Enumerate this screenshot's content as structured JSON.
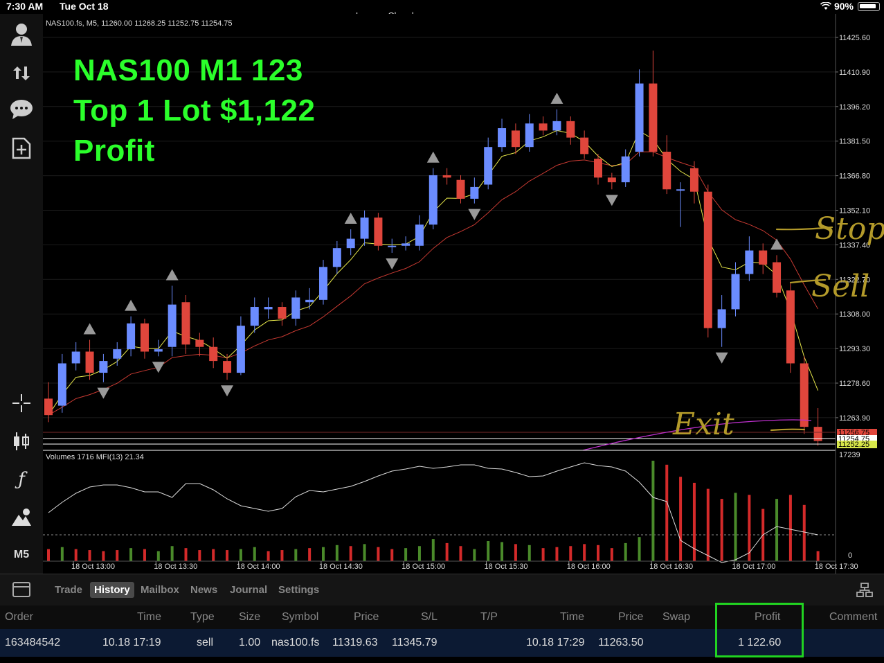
{
  "status": {
    "time": "7:30 AM",
    "date": "Tue Oct 18",
    "battery": "90%",
    "window_title": "Lennox Chambers"
  },
  "chart_info": "NAS100.fs, M5, 11260.00 11268.25 11252.75 11254.75",
  "overlay": {
    "line1": "NAS100 M1 123",
    "line2": "Top  1 Lot $1,122",
    "line3": "Profit"
  },
  "annotations": {
    "stop": "Stop",
    "sell": "Sell",
    "exit": "Exit"
  },
  "sidebar": {
    "timeframe": "M5",
    "icons": [
      "account-icon",
      "transfer-icon",
      "chat-icon",
      "new-order-icon",
      "crosshair-icon",
      "chart-type-icon",
      "indicators-icon",
      "objects-icon"
    ]
  },
  "volume_info": "Volumes 1716 MFI(13) 21.34",
  "volume_axis": {
    "max": "17239",
    "min": "0"
  },
  "chart_data": {
    "type": "candlestick",
    "symbol": "NAS100.fs",
    "timeframe": "M5",
    "price_axis": [
      "11425.60",
      "11410.90",
      "11396.20",
      "11381.50",
      "11366.80",
      "11352.10",
      "11337.40",
      "11322.70",
      "11308.00",
      "11293.30",
      "11278.60",
      "11263.90"
    ],
    "price_tags": [
      {
        "label": "11256.75",
        "color": "#e0463c"
      },
      {
        "label": "11254.75",
        "color": "#ffffff"
      },
      {
        "label": "11252.25",
        "color": "#d8e84a"
      }
    ],
    "ylim": [
      11252.25,
      11425.6
    ],
    "x_labels": [
      "18 Oct 13:00",
      "18 Oct 13:30",
      "18 Oct 14:00",
      "18 Oct 14:30",
      "18 Oct 15:00",
      "18 Oct 15:30",
      "18 Oct 16:00",
      "18 Oct 16:30",
      "18 Oct 17:00",
      "18 Oct 17:30"
    ],
    "candles": [
      {
        "o": 11272,
        "c": 11265,
        "h": 11279,
        "l": 11262
      },
      {
        "o": 11269,
        "c": 11287,
        "h": 11291,
        "l": 11266
      },
      {
        "o": 11287,
        "c": 11292,
        "h": 11296,
        "l": 11284
      },
      {
        "o": 11292,
        "c": 11283,
        "h": 11297,
        "l": 11280
      },
      {
        "o": 11283,
        "c": 11288,
        "h": 11291,
        "l": 11279
      },
      {
        "o": 11289,
        "c": 11293,
        "h": 11296,
        "l": 11286
      },
      {
        "o": 11293,
        "c": 11304,
        "h": 11307,
        "l": 11290
      },
      {
        "o": 11304,
        "c": 11292,
        "h": 11306,
        "l": 11289
      },
      {
        "o": 11292,
        "c": 11293,
        "h": 11297,
        "l": 11290
      },
      {
        "o": 11294,
        "c": 11312,
        "h": 11320,
        "l": 11290
      },
      {
        "o": 11313,
        "c": 11295,
        "h": 11316,
        "l": 11291
      },
      {
        "o": 11297,
        "c": 11294,
        "h": 11300,
        "l": 11290
      },
      {
        "o": 11294,
        "c": 11288,
        "h": 11298,
        "l": 11285
      },
      {
        "o": 11288,
        "c": 11283,
        "h": 11291,
        "l": 11280
      },
      {
        "o": 11283,
        "c": 11303,
        "h": 11307,
        "l": 11282
      },
      {
        "o": 11303,
        "c": 11311,
        "h": 11315,
        "l": 11300
      },
      {
        "o": 11310,
        "c": 11311,
        "h": 11315,
        "l": 11306
      },
      {
        "o": 11311,
        "c": 11306,
        "h": 11313,
        "l": 11303
      },
      {
        "o": 11306,
        "c": 11315,
        "h": 11318,
        "l": 11303
      },
      {
        "o": 11313,
        "c": 11314,
        "h": 11319,
        "l": 11310
      },
      {
        "o": 11314,
        "c": 11328,
        "h": 11331,
        "l": 11312
      },
      {
        "o": 11328,
        "c": 11336,
        "h": 11339,
        "l": 11325
      },
      {
        "o": 11336,
        "c": 11340,
        "h": 11344,
        "l": 11333
      },
      {
        "o": 11340,
        "c": 11349,
        "h": 11352,
        "l": 11337
      },
      {
        "o": 11349,
        "c": 11337,
        "h": 11351,
        "l": 11335
      },
      {
        "o": 11337,
        "c": 11337,
        "h": 11340,
        "l": 11334
      },
      {
        "o": 11337,
        "c": 11338,
        "h": 11341,
        "l": 11335
      },
      {
        "o": 11337,
        "c": 11346,
        "h": 11350,
        "l": 11335
      },
      {
        "o": 11346,
        "c": 11367,
        "h": 11370,
        "l": 11344
      },
      {
        "o": 11367,
        "c": 11366,
        "h": 11370,
        "l": 11363
      },
      {
        "o": 11365,
        "c": 11357,
        "h": 11367,
        "l": 11355
      },
      {
        "o": 11357,
        "c": 11362,
        "h": 11366,
        "l": 11355
      },
      {
        "o": 11363,
        "c": 11379,
        "h": 11383,
        "l": 11361
      },
      {
        "o": 11379,
        "c": 11387,
        "h": 11391,
        "l": 11377
      },
      {
        "o": 11386,
        "c": 11379,
        "h": 11389,
        "l": 11376
      },
      {
        "o": 11379,
        "c": 11389,
        "h": 11393,
        "l": 11377
      },
      {
        "o": 11389,
        "c": 11386,
        "h": 11392,
        "l": 11384
      },
      {
        "o": 11386,
        "c": 11390,
        "h": 11395,
        "l": 11384
      },
      {
        "o": 11390,
        "c": 11383,
        "h": 11392,
        "l": 11380
      },
      {
        "o": 11383,
        "c": 11376,
        "h": 11386,
        "l": 11374
      },
      {
        "o": 11374,
        "c": 11366,
        "h": 11376,
        "l": 11363
      },
      {
        "o": 11366,
        "c": 11364,
        "h": 11368,
        "l": 11361
      },
      {
        "o": 11364,
        "c": 11375,
        "h": 11378,
        "l": 11362
      },
      {
        "o": 11377,
        "c": 11406,
        "h": 11412,
        "l": 11375
      },
      {
        "o": 11406,
        "c": 11377,
        "h": 11420,
        "l": 11375
      },
      {
        "o": 11377,
        "c": 11361,
        "h": 11384,
        "l": 11359
      },
      {
        "o": 11361,
        "c": 11361,
        "h": 11364,
        "l": 11345
      },
      {
        "o": 11370,
        "c": 11360,
        "h": 11373,
        "l": 11355
      },
      {
        "o": 11360,
        "c": 11302,
        "h": 11363,
        "l": 11298
      },
      {
        "o": 11302,
        "c": 11310,
        "h": 11316,
        "l": 11294
      },
      {
        "o": 11310,
        "c": 11325,
        "h": 11330,
        "l": 11307
      },
      {
        "o": 11325,
        "c": 11335,
        "h": 11341,
        "l": 11322
      },
      {
        "o": 11335,
        "c": 11329,
        "h": 11338,
        "l": 11325
      },
      {
        "o": 11330,
        "c": 11317,
        "h": 11333,
        "l": 11315
      },
      {
        "o": 11318,
        "c": 11287,
        "h": 11321,
        "l": 11283
      },
      {
        "o": 11287,
        "c": 11260,
        "h": 11290,
        "l": 11257
      },
      {
        "o": 11260,
        "c": 11254,
        "h": 11268,
        "l": 11252
      }
    ],
    "volume_bars": [
      {
        "v": 12,
        "up": false
      },
      {
        "v": 14,
        "up": true
      },
      {
        "v": 12,
        "up": false
      },
      {
        "v": 11,
        "up": false
      },
      {
        "v": 10,
        "up": false
      },
      {
        "v": 11,
        "up": false
      },
      {
        "v": 13,
        "up": true
      },
      {
        "v": 12,
        "up": false
      },
      {
        "v": 10,
        "up": true
      },
      {
        "v": 15,
        "up": true
      },
      {
        "v": 13,
        "up": false
      },
      {
        "v": 11,
        "up": false
      },
      {
        "v": 12,
        "up": false
      },
      {
        "v": 11,
        "up": false
      },
      {
        "v": 12,
        "up": true
      },
      {
        "v": 14,
        "up": true
      },
      {
        "v": 10,
        "up": false
      },
      {
        "v": 11,
        "up": false
      },
      {
        "v": 12,
        "up": true
      },
      {
        "v": 13,
        "up": false
      },
      {
        "v": 14,
        "up": true
      },
      {
        "v": 16,
        "up": true
      },
      {
        "v": 15,
        "up": false
      },
      {
        "v": 17,
        "up": true
      },
      {
        "v": 14,
        "up": false
      },
      {
        "v": 12,
        "up": false
      },
      {
        "v": 13,
        "up": true
      },
      {
        "v": 15,
        "up": true
      },
      {
        "v": 22,
        "up": true
      },
      {
        "v": 18,
        "up": false
      },
      {
        "v": 15,
        "up": false
      },
      {
        "v": 12,
        "up": true
      },
      {
        "v": 20,
        "up": true
      },
      {
        "v": 19,
        "up": true
      },
      {
        "v": 17,
        "up": false
      },
      {
        "v": 16,
        "up": true
      },
      {
        "v": 13,
        "up": false
      },
      {
        "v": 14,
        "up": false
      },
      {
        "v": 15,
        "up": false
      },
      {
        "v": 17,
        "up": false
      },
      {
        "v": 16,
        "up": false
      },
      {
        "v": 13,
        "up": false
      },
      {
        "v": 18,
        "up": true
      },
      {
        "v": 24,
        "up": true
      },
      {
        "v": 100,
        "up": true
      },
      {
        "v": 96,
        "up": false
      },
      {
        "v": 84,
        "up": false
      },
      {
        "v": 78,
        "up": false
      },
      {
        "v": 72,
        "up": false
      },
      {
        "v": 62,
        "up": false
      },
      {
        "v": 68,
        "up": true
      },
      {
        "v": 66,
        "up": false
      },
      {
        "v": 52,
        "up": false
      },
      {
        "v": 62,
        "up": true
      },
      {
        "v": 66,
        "up": false
      },
      {
        "v": 56,
        "up": false
      },
      {
        "v": 10,
        "up": false
      }
    ],
    "colors": {
      "bull": "#6b8cff",
      "bear": "#e0463c",
      "vol_up": "#4a8a2a",
      "vol_down": "#d42a2a",
      "ma_fast": "#e8e84a",
      "ma_slow": "#c83a32",
      "mfi": "#dddddd",
      "purple": "#c030d0",
      "overlay_text": "#2bff2b",
      "annotation": "#b39a2a"
    }
  },
  "tabs": [
    {
      "label": "Trade",
      "active": false
    },
    {
      "label": "History",
      "active": true
    },
    {
      "label": "Mailbox",
      "active": false
    },
    {
      "label": "News",
      "active": false
    },
    {
      "label": "Journal",
      "active": false
    },
    {
      "label": "Settings",
      "active": false
    }
  ],
  "history": {
    "columns": [
      "Order",
      "Time",
      "Type",
      "Size",
      "Symbol",
      "Price",
      "S/L",
      "T/P",
      "Time",
      "Price",
      "Swap",
      "Profit",
      "Comment"
    ],
    "row": {
      "order": "163484542",
      "open_time": "10.18 17:19",
      "type": "sell",
      "size": "1.00",
      "symbol": "nas100.fs",
      "open_price": "11319.63",
      "sl": "11345.79",
      "tp": "",
      "close_time": "10.18 17:29",
      "close_price": "11263.50",
      "swap": "",
      "profit": "1 122.60",
      "comment": ""
    }
  }
}
